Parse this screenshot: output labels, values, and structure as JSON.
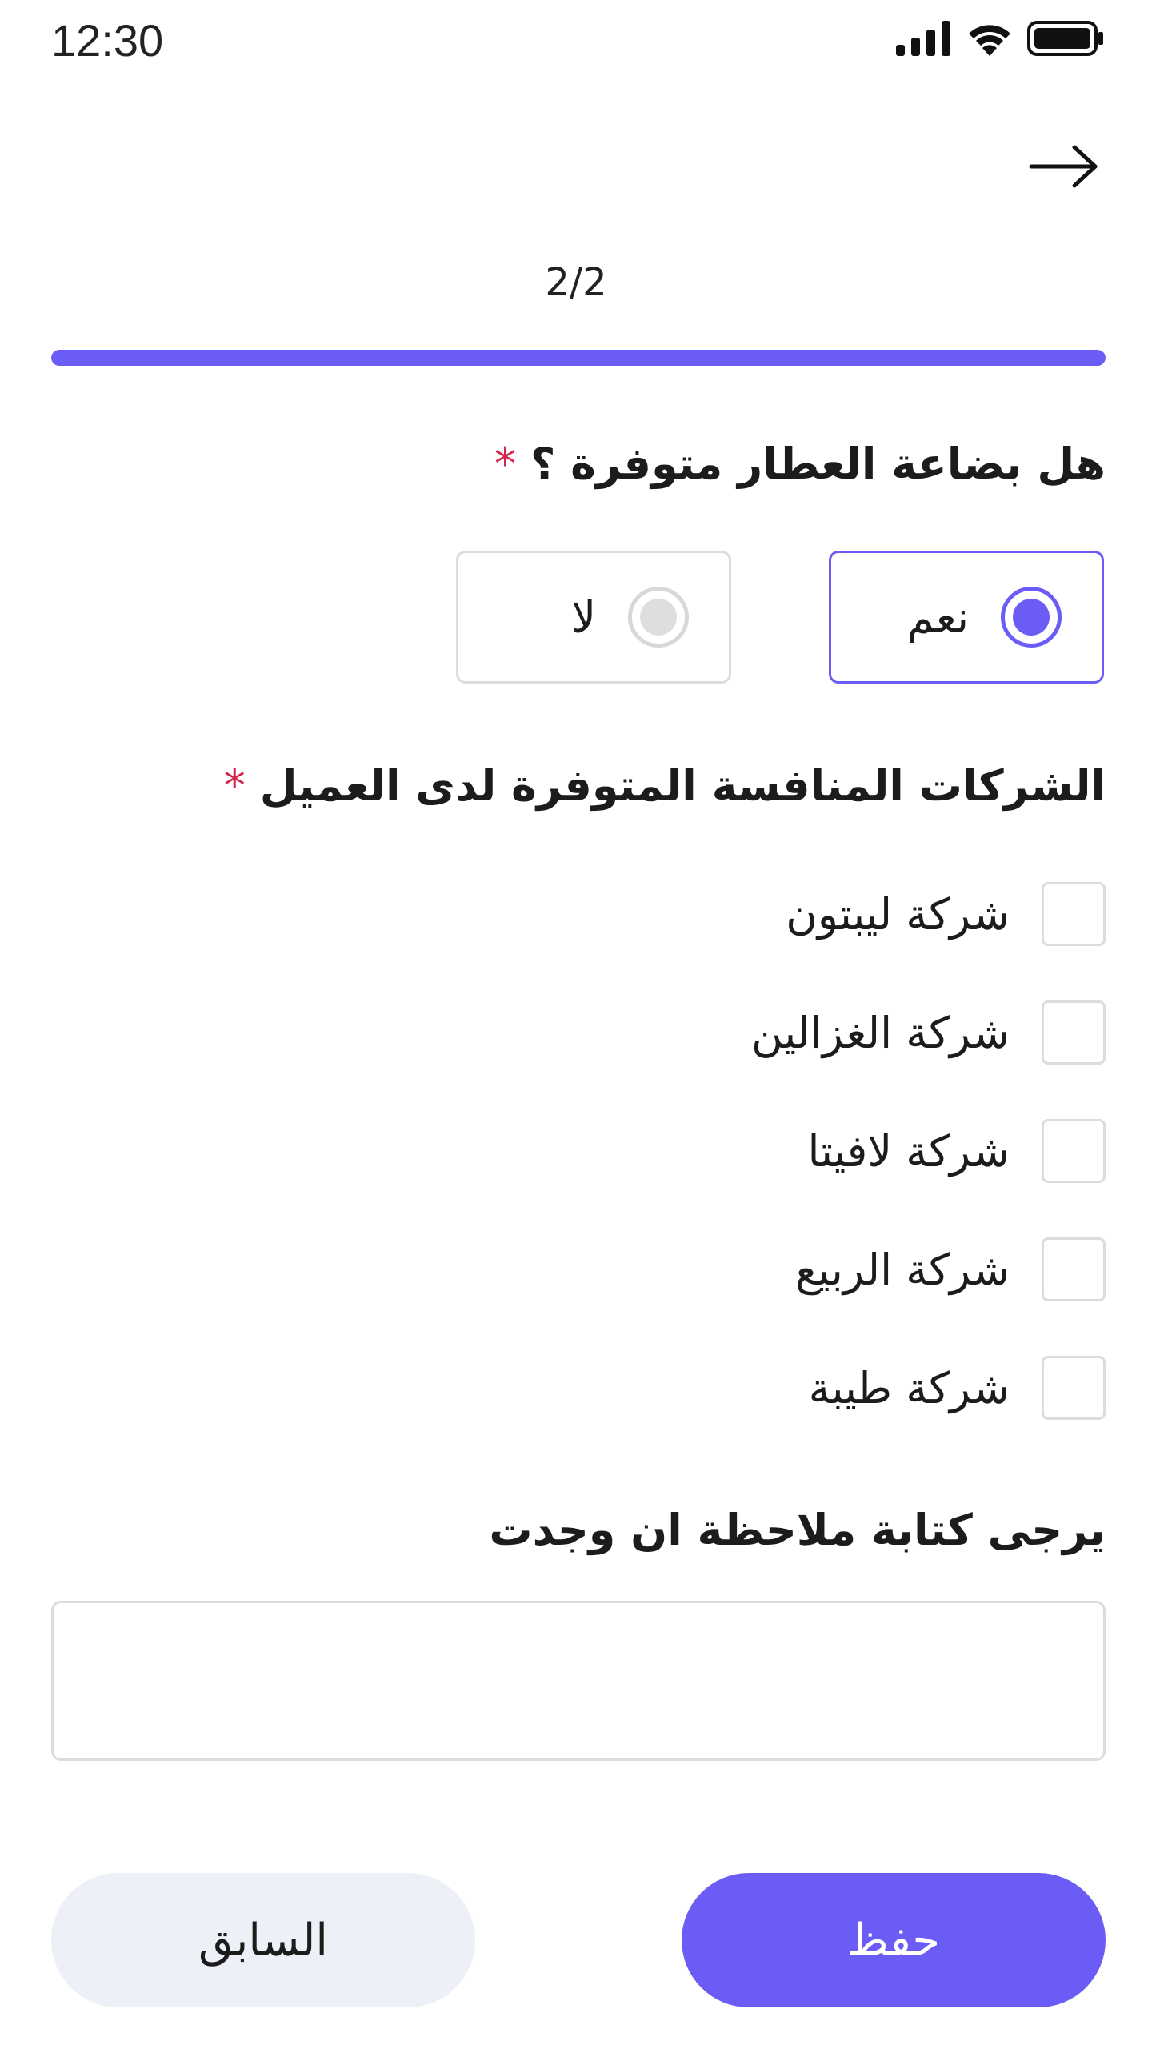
{
  "status_bar": {
    "time": "12:30",
    "icons": [
      "signal-icon",
      "wifi-icon",
      "battery-icon"
    ]
  },
  "header": {
    "back_icon": "arrow-right-icon"
  },
  "progress": {
    "label": "2/2",
    "value": 1.0,
    "color": "#6c5cf6"
  },
  "question_1": {
    "label": "هل بضاعة العطار متوفرة ؟",
    "required_mark": "*",
    "options": [
      {
        "label": "نعم",
        "selected": true
      },
      {
        "label": "لا",
        "selected": false
      }
    ]
  },
  "question_2": {
    "label": "الشركات المنافسة المتوفرة لدى العميل",
    "required_mark": "*",
    "options": [
      {
        "label": "شركة ليبتون",
        "checked": false
      },
      {
        "label": "شركة الغزالين",
        "checked": false
      },
      {
        "label": "شركة لافيتا",
        "checked": false
      },
      {
        "label": "شركة الربيع",
        "checked": false
      },
      {
        "label": "شركة طيبة",
        "checked": false
      }
    ]
  },
  "question_3": {
    "label": "يرجى كتابة ملاحظة ان وجدت",
    "value": "",
    "placeholder": ""
  },
  "buttons": {
    "save_label": "حفظ",
    "previous_label": "السابق"
  },
  "colors": {
    "accent": "#6c5cf6",
    "required": "#d6254b",
    "secondary_button": "#edf0f7",
    "border": "#dcdcdc"
  }
}
